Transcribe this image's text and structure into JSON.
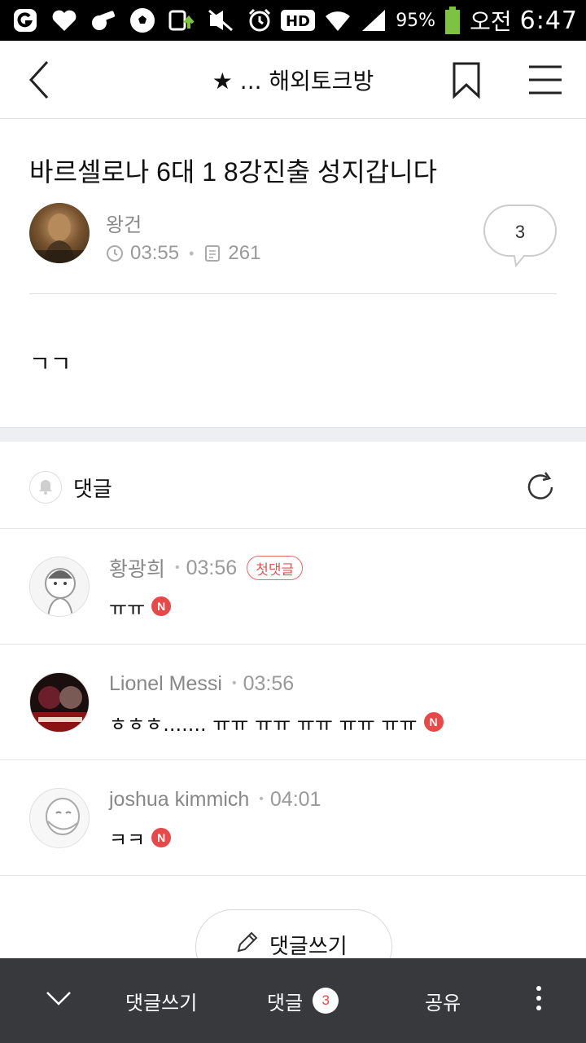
{
  "status_bar": {
    "battery": "95%",
    "network_label": "HD",
    "ampm": "오전",
    "time": "6:47"
  },
  "header": {
    "title": "★ ... 해외토크방"
  },
  "post": {
    "title": "바르셀로나 6대 1 8강진출 성지갑니다",
    "author": "왕건",
    "time": "03:55",
    "views": "261",
    "comment_count": "3",
    "body": "ㄱㄱ"
  },
  "comments_section": {
    "label": "댓글",
    "items": [
      {
        "name": "황광희",
        "time": "03:56",
        "badge": "첫댓글",
        "text": "ㅠㅠ",
        "new": "N"
      },
      {
        "name": "Lionel Messi",
        "time": "03:56",
        "badge": "",
        "text": "ㅎㅎㅎ....... ㅠㅠ ㅠㅠ ㅠㅠ ㅠㅠ ㅠㅠ",
        "new": "N"
      },
      {
        "name": "joshua kimmich",
        "time": "04:01",
        "badge": "",
        "text": "ㅋㅋ",
        "new": "N"
      }
    ],
    "write_label": "댓글쓰기"
  },
  "bottom_bar": {
    "write_label": "댓글쓰기",
    "comments_label": "댓글",
    "comments_count": "3",
    "share_label": "공유"
  },
  "colors": {
    "accent_red": "#e74848",
    "bottom_bar_bg": "#38393d"
  }
}
